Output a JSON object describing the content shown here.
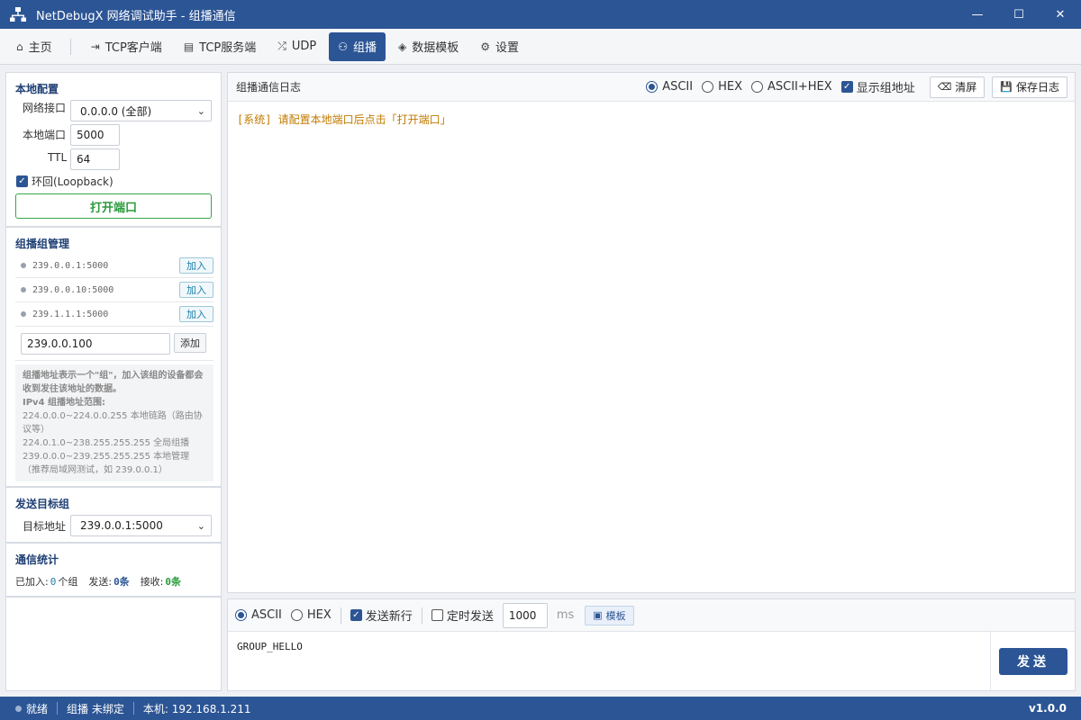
{
  "window": {
    "title": "NetDebugX 网络调试助手 - 组播通信",
    "minimize_glyph": "—",
    "maximize_glyph": "☐",
    "close_glyph": "✕"
  },
  "tabs": [
    {
      "label": "主页",
      "icon": "home-icon"
    },
    {
      "label": "TCP客户端",
      "icon": "login-icon"
    },
    {
      "label": "TCP服务端",
      "icon": "server-icon"
    },
    {
      "label": "UDP",
      "icon": "shuffle-icon"
    },
    {
      "label": "组播",
      "icon": "sitemap-icon"
    },
    {
      "label": "数据模板",
      "icon": "cube-icon"
    },
    {
      "label": "设置",
      "icon": "gear-icon"
    }
  ],
  "local_config": {
    "heading": "本地配置",
    "interface_label": "网络接口",
    "interface_value": "0.0.0.0 (全部)",
    "port_label": "本地端口",
    "port_value": "5000",
    "ttl_label": "TTL",
    "ttl_value": "64",
    "loopback_label": "环回(Loopback)",
    "loopback_checked": true,
    "open_button": "打开端口"
  },
  "group_mgmt": {
    "heading": "组播组管理",
    "groups": [
      {
        "addr": "239.0.0.1:5000",
        "action": "加入"
      },
      {
        "addr": "239.0.0.10:5000",
        "action": "加入"
      },
      {
        "addr": "239.1.1.1:5000",
        "action": "加入"
      }
    ],
    "new_group_value": "239.0.0.100",
    "add_button": "添加",
    "note": {
      "line1": "组播地址表示一个\"组\"，加入该组的设备都会收到发往该地址的数据。",
      "range_title": "IPv4 组播地址范围:",
      "range1": "224.0.0.0~224.0.0.255 本地链路（路由协议等）",
      "range2": "224.0.1.0~238.255.255.255 全局组播",
      "range3": "239.0.0.0~239.255.255.255 本地管理（推荐局域网测试，如 239.0.0.1）"
    }
  },
  "send_target": {
    "heading": "发送目标组",
    "label": "目标地址",
    "value": "239.0.0.1:5000"
  },
  "stats": {
    "heading": "通信统计",
    "joined_label": "已加入:",
    "joined_value": "0",
    "joined_unit": "个组",
    "sent_label": "发送:",
    "sent_value": "0条",
    "recv_label": "接收:",
    "recv_value": "0条"
  },
  "log": {
    "title": "组播通信日志",
    "mode_ascii": "ASCII",
    "mode_hex": "HEX",
    "mode_both": "ASCII+HEX",
    "show_group_label": "显示组地址",
    "clear_button": "清屏",
    "save_button": "保存日志",
    "lines": [
      "[系统] 请配置本地端口后点击「打开端口」"
    ]
  },
  "send": {
    "mode_ascii": "ASCII",
    "mode_hex": "HEX",
    "newline_label": "发送新行",
    "timer_label": "定时发送",
    "interval_value": "1000",
    "interval_unit": "ms",
    "template_button": "模板",
    "text": "GROUP_HELLO",
    "send_button": "发送"
  },
  "status": {
    "state": "就绪",
    "bind": "组播 未绑定",
    "local": "本机: 192.168.1.211",
    "version": "v1.0.0"
  },
  "colors": {
    "primary": "#2c5595",
    "accent_green": "#2a9a3c",
    "log_system": "#c07a00",
    "count_blue": "#1a7fa8"
  }
}
